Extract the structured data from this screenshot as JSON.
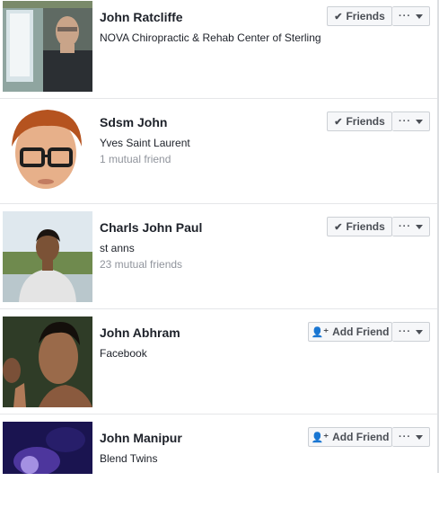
{
  "people": [
    {
      "name": "John Ratcliffe",
      "subtitle": "NOVA Chiropractic & Rehab Center of Sterling",
      "mutual": "",
      "action": "Friends",
      "action_icon": "checkmark-icon"
    },
    {
      "name": "Sdsm John",
      "subtitle": "Yves Saint Laurent",
      "mutual": "1 mutual friend",
      "action": "Friends",
      "action_icon": "checkmark-icon"
    },
    {
      "name": "Charls John Paul",
      "subtitle": "st anns",
      "mutual": "23 mutual friends",
      "action": "Friends",
      "action_icon": "checkmark-icon"
    },
    {
      "name": "John Abhram",
      "subtitle": "Facebook",
      "mutual": "",
      "action": "Add Friend",
      "action_icon": "add-friend-icon"
    },
    {
      "name": "John Manipur",
      "subtitle": "Blend Twins",
      "mutual": "",
      "action": "Add Friend",
      "action_icon": "add-friend-icon"
    }
  ],
  "more_label": "···",
  "colors": {
    "name_text": "#1d2129",
    "muted_text": "#90949c",
    "button_bg": "#f6f7f9",
    "button_border": "#ccd0d5",
    "separator": "#e5e6e9"
  }
}
